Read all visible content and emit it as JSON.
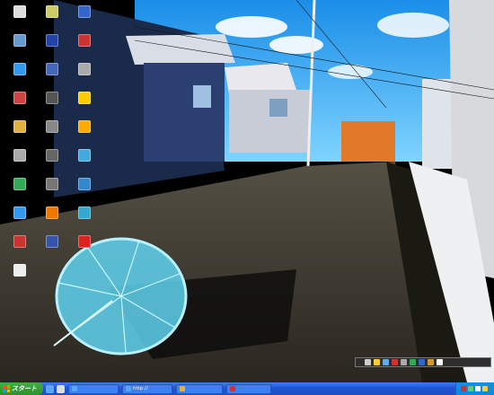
{
  "desktop": {
    "icons": [
      {
        "label": "",
        "icon": "top-left-icon",
        "color": "#dddddd"
      },
      {
        "label": "",
        "icon": "document-icon",
        "color": "#cccc66"
      },
      {
        "label": "",
        "icon": "network-icon",
        "color": "#3366cc"
      },
      {
        "label": "",
        "icon": "internet-icon",
        "color": "#6699cc"
      },
      {
        "label": "",
        "icon": "word-icon",
        "color": "#2244aa"
      },
      {
        "label": "",
        "icon": "media-icon",
        "color": "#cc3333"
      },
      {
        "label": "",
        "icon": "ie-icon",
        "color": "#3399ee"
      },
      {
        "label": "",
        "icon": "app-icon",
        "color": "#4466bb"
      },
      {
        "label": "",
        "icon": "tool-icon",
        "color": "#aaaaaa"
      },
      {
        "label": "",
        "icon": "setup-icon",
        "color": "#cc4444"
      },
      {
        "label": "",
        "icon": "app-icon",
        "color": "#555555"
      },
      {
        "label": "",
        "icon": "sun-icon",
        "color": "#ffcc00"
      },
      {
        "label": "",
        "icon": "folder-icon",
        "color": "#e0b040"
      },
      {
        "label": "",
        "icon": "gear-icon",
        "color": "#888888"
      },
      {
        "label": "",
        "icon": "sun-icon",
        "color": "#ffaa00"
      },
      {
        "label": "",
        "icon": "tool-icon",
        "color": "#aaaaaa"
      },
      {
        "label": "",
        "icon": "app-icon",
        "color": "#666666"
      },
      {
        "label": "",
        "icon": "bird-icon",
        "color": "#44aadd"
      },
      {
        "label": "",
        "icon": "media-icon",
        "color": "#33aa55"
      },
      {
        "label": "",
        "icon": "app-icon",
        "color": "#777777"
      },
      {
        "label": "",
        "icon": "globe-icon",
        "color": "#3388cc"
      },
      {
        "label": "",
        "icon": "ie-icon",
        "color": "#3399ee"
      },
      {
        "label": "",
        "icon": "acrobat-icon",
        "color": "#ee7700"
      },
      {
        "label": "",
        "icon": "app-icon",
        "color": "#33aacc"
      },
      {
        "label": "",
        "icon": "app-icon",
        "color": "#cc3333"
      },
      {
        "label": "",
        "icon": "photoshop-icon",
        "color": "#3355aa"
      },
      {
        "label": "",
        "icon": "pdf-icon",
        "color": "#dd2222"
      },
      {
        "label": "",
        "icon": "pdf-icon",
        "color": "#eeeeee"
      }
    ]
  },
  "quicktray": {
    "word_label": "",
    "icons": [
      {
        "icon": "doc-icon",
        "color": "#cccccc"
      },
      {
        "icon": "star-icon",
        "color": "#ffcc33"
      },
      {
        "icon": "chat-icon",
        "color": "#66aaee"
      },
      {
        "icon": "flag-icon",
        "color": "#cc3333"
      },
      {
        "icon": "tool-icon",
        "color": "#aaaaaa"
      },
      {
        "icon": "app-icon",
        "color": "#33aa55"
      },
      {
        "icon": "app-icon",
        "color": "#3366cc"
      },
      {
        "icon": "app-icon",
        "color": "#cc9933"
      },
      {
        "icon": "help-icon",
        "color": "#ffffff"
      }
    ]
  },
  "taskbar": {
    "start_label": "スタート",
    "quick_launch": [
      {
        "icon": "ie-icon",
        "color": "#55aaff"
      },
      {
        "icon": "desktop-icon",
        "color": "#dddddd"
      }
    ],
    "tasks": [
      {
        "label": "",
        "icon": "ie-icon",
        "color": "#55aaff"
      },
      {
        "label": "http://",
        "icon": "ie-icon",
        "color": "#55aaff"
      },
      {
        "label": "",
        "icon": "folder-icon",
        "color": "#e0b040"
      },
      {
        "label": "",
        "icon": "media-icon",
        "color": "#cc3333"
      }
    ],
    "tray": {
      "text": "",
      "icons": [
        {
          "icon": "security-icon",
          "color": "#cc3333"
        },
        {
          "icon": "network-icon",
          "color": "#66cc66"
        },
        {
          "icon": "volume-icon",
          "color": "#ffffff"
        },
        {
          "icon": "app-icon",
          "color": "#ffcc33"
        }
      ],
      "clock": ""
    }
  }
}
